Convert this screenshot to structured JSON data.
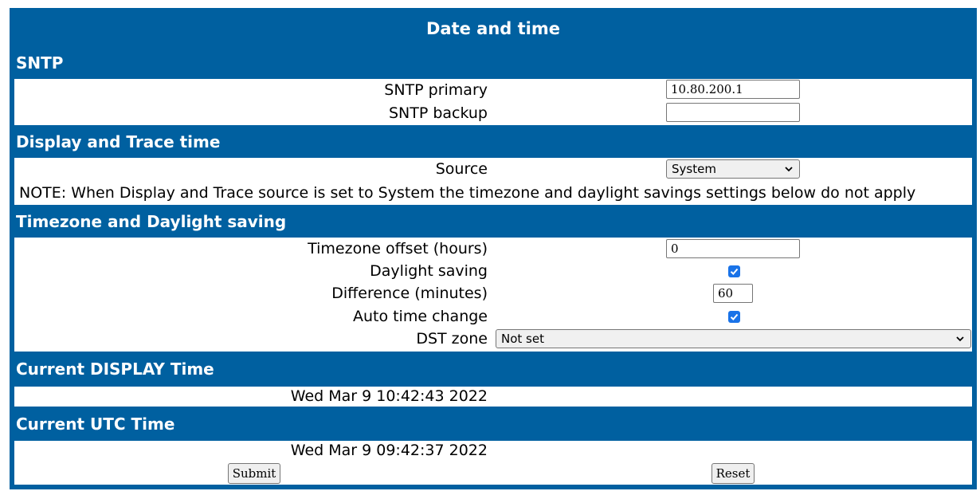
{
  "page": {
    "title": "Date and time"
  },
  "sntp": {
    "heading": "SNTP",
    "primary_label": "SNTP primary",
    "primary_value": "10.80.200.1",
    "backup_label": "SNTP backup",
    "backup_value": ""
  },
  "display_trace": {
    "heading": "Display and Trace time",
    "source_label": "Source",
    "source_value": "System",
    "note": "NOTE: When Display and Trace source is set to System the timezone and daylight savings settings below do not apply"
  },
  "timezone": {
    "heading": "Timezone and Daylight saving",
    "offset_label": "Timezone offset (hours)",
    "offset_value": "0",
    "daylight_label": "Daylight saving",
    "daylight_checked": true,
    "difference_label": "Difference (minutes)",
    "difference_value": "60",
    "auto_label": "Auto time change",
    "auto_checked": true,
    "dst_label": "DST zone",
    "dst_value": "Not set"
  },
  "display_time": {
    "heading": "Current DISPLAY Time",
    "value": "Wed Mar 9 10:42:43 2022"
  },
  "utc_time": {
    "heading": "Current UTC Time",
    "value": "Wed Mar 9 09:42:37 2022"
  },
  "actions": {
    "submit_label": "Submit",
    "reset_label": "Reset"
  },
  "colors": {
    "header_blue": "#0060a0",
    "checkbox_blue": "#1a73e8"
  }
}
